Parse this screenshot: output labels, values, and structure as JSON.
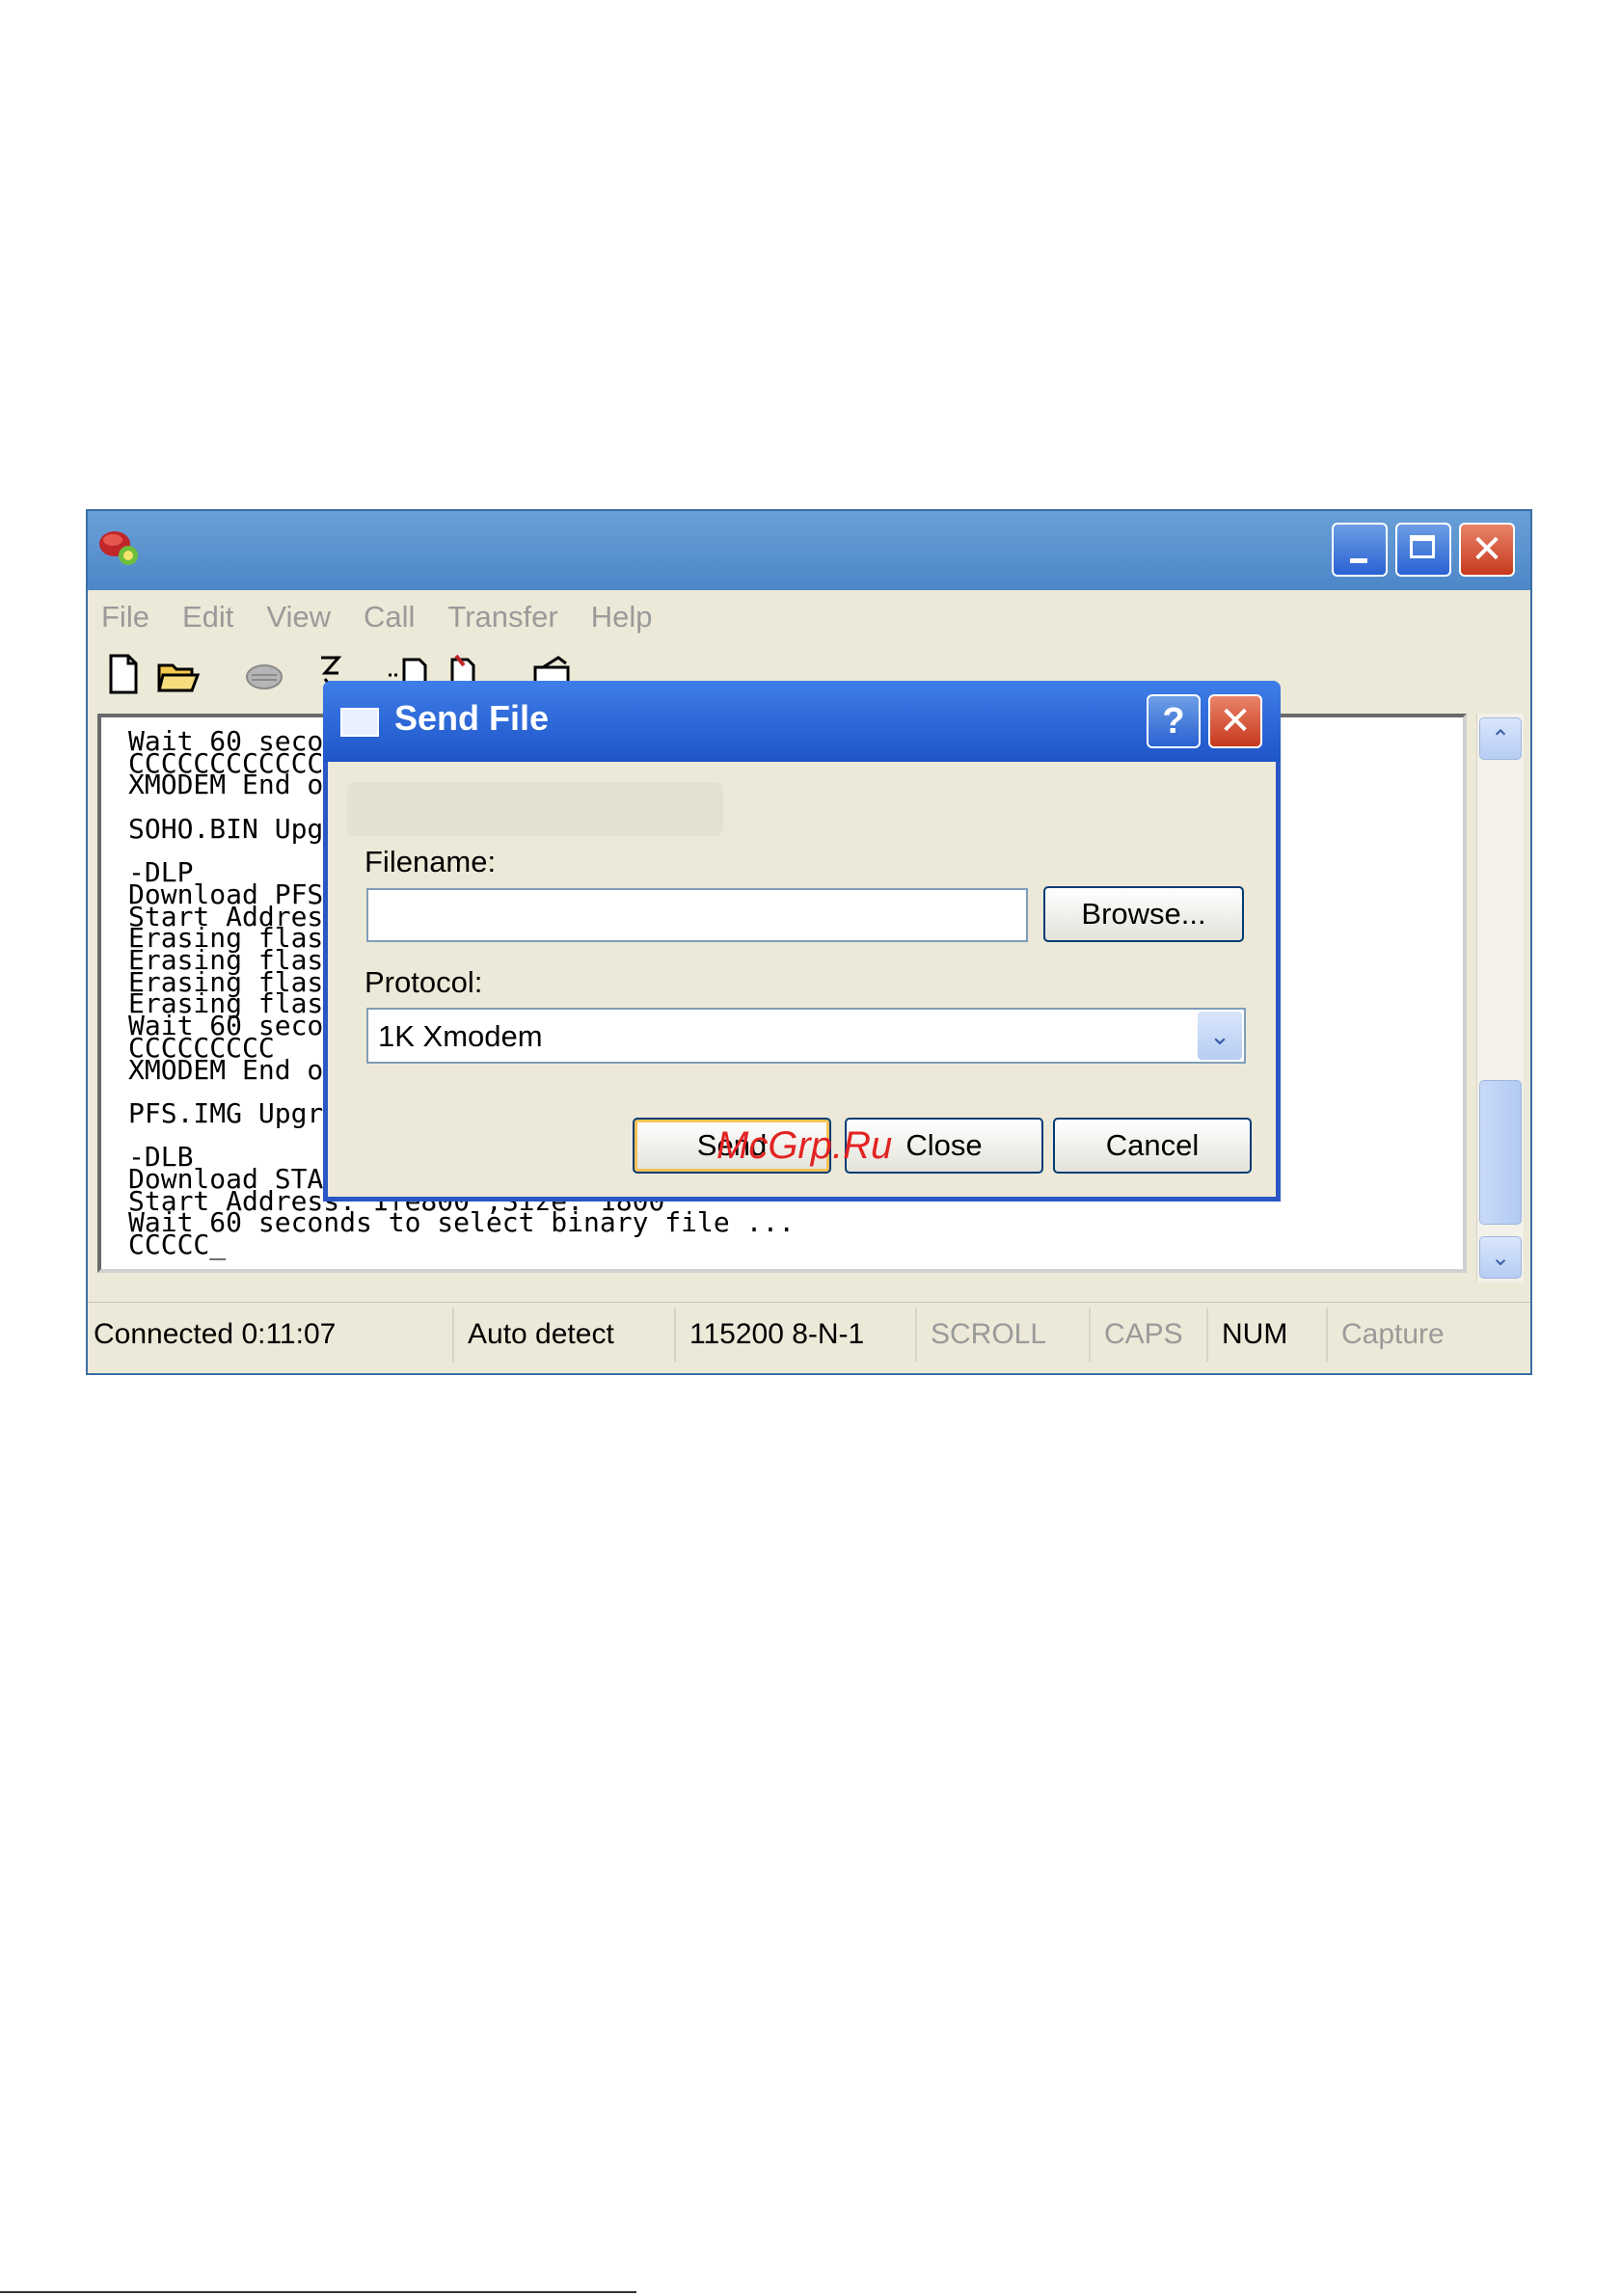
{
  "window": {
    "menu": [
      "File",
      "Edit",
      "View",
      "Call",
      "Transfer",
      "Help"
    ],
    "terminal_lines": [
      "Wait 60 seco",
      "CCCCCCCCCCCC",
      "XMODEM End o",
      "",
      "SOHO.BIN Upg",
      "",
      "-DLP",
      "Download PFS",
      "Start Addres",
      "Erasing flas",
      "Erasing flas",
      "Erasing flas",
      "Erasing flas",
      "Wait 60 seco",
      "CCCCCCCCC",
      "XMODEM End o",
      "",
      "PFS.IMG Upgr",
      "",
      "-DLB",
      "Download STA",
      "Start Address: 1fe800 ,Size: 1800",
      "Wait 60 seconds to select binary file ...",
      "CCCCC_"
    ],
    "status": {
      "connected": "Connected 0:11:07",
      "detect": "Auto detect",
      "settings": "115200 8-N-1",
      "scroll": "SCROLL",
      "caps": "CAPS",
      "num": "NUM",
      "capture": "Capture"
    }
  },
  "dialog": {
    "title": "Send File",
    "help_label": "?",
    "filename_label": "Filename:",
    "filename_value": "",
    "browse_label": "Browse...",
    "protocol_label": "Protocol:",
    "protocol_value": "1K Xmodem",
    "send_label": "Send",
    "close_label": "Close",
    "cancel_label": "Cancel"
  },
  "watermark": "McGrp.Ru",
  "colors": {
    "title_blue": "#1e55c8",
    "window_bg": "#ece9d8",
    "watermark_red": "#e32222"
  }
}
